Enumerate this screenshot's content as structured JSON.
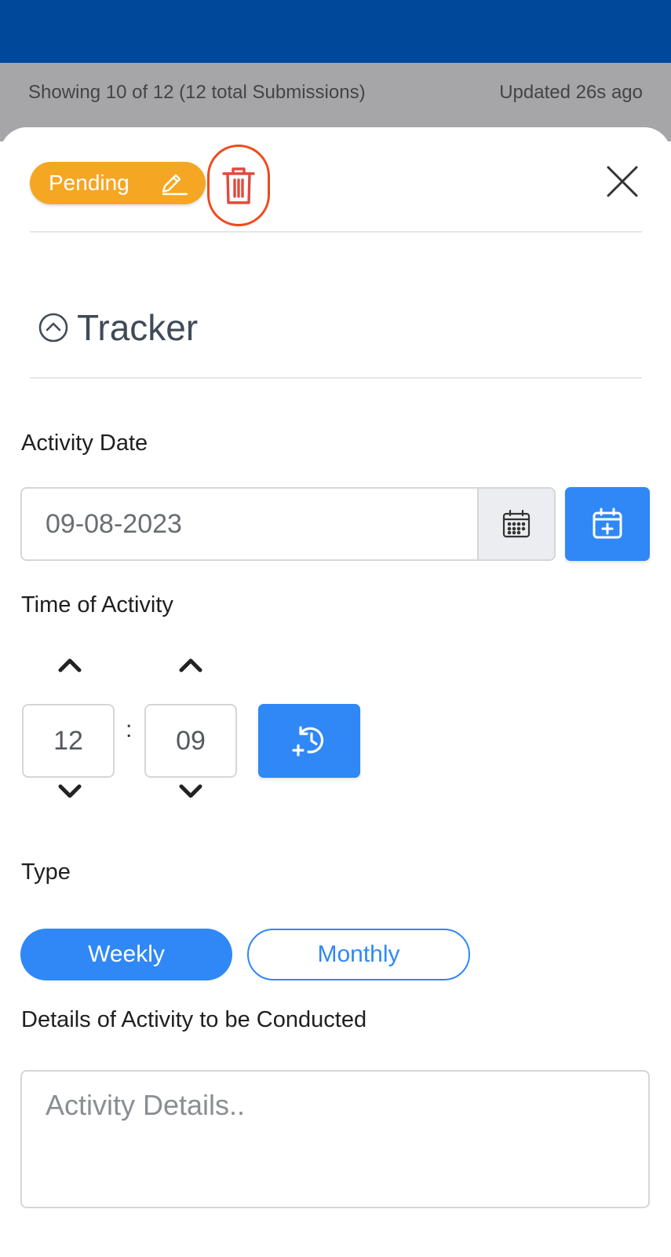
{
  "header": {
    "submissions_text": "Showing 10 of 12 (12 total Submissions)",
    "updated_text": "Updated 26s ago"
  },
  "sheet": {
    "status_label": "Pending",
    "status_color": "#f5a623",
    "delete_icon": "trash-icon",
    "close_icon": "close-icon",
    "section_title": "Tracker",
    "section_icon": "chevron-up-circle-icon"
  },
  "form": {
    "activity_date": {
      "label": "Activity Date",
      "value": "09-08-2023",
      "addon_icon": "calendar-grid-icon",
      "button_icon": "calendar-plus-icon"
    },
    "time": {
      "label": "Time of Activity",
      "hour": "12",
      "minute": "09",
      "separator": ":",
      "button_icon": "add-time-icon"
    },
    "type": {
      "label": "Type",
      "options": [
        "Weekly",
        "Monthly"
      ],
      "selected": "Weekly"
    },
    "details": {
      "label": "Details of Activity to be Conducted",
      "placeholder": "Activity Details.."
    }
  },
  "colors": {
    "topbar": "#00489a",
    "accent": "#2f88f5",
    "danger": "#e14a3c"
  }
}
